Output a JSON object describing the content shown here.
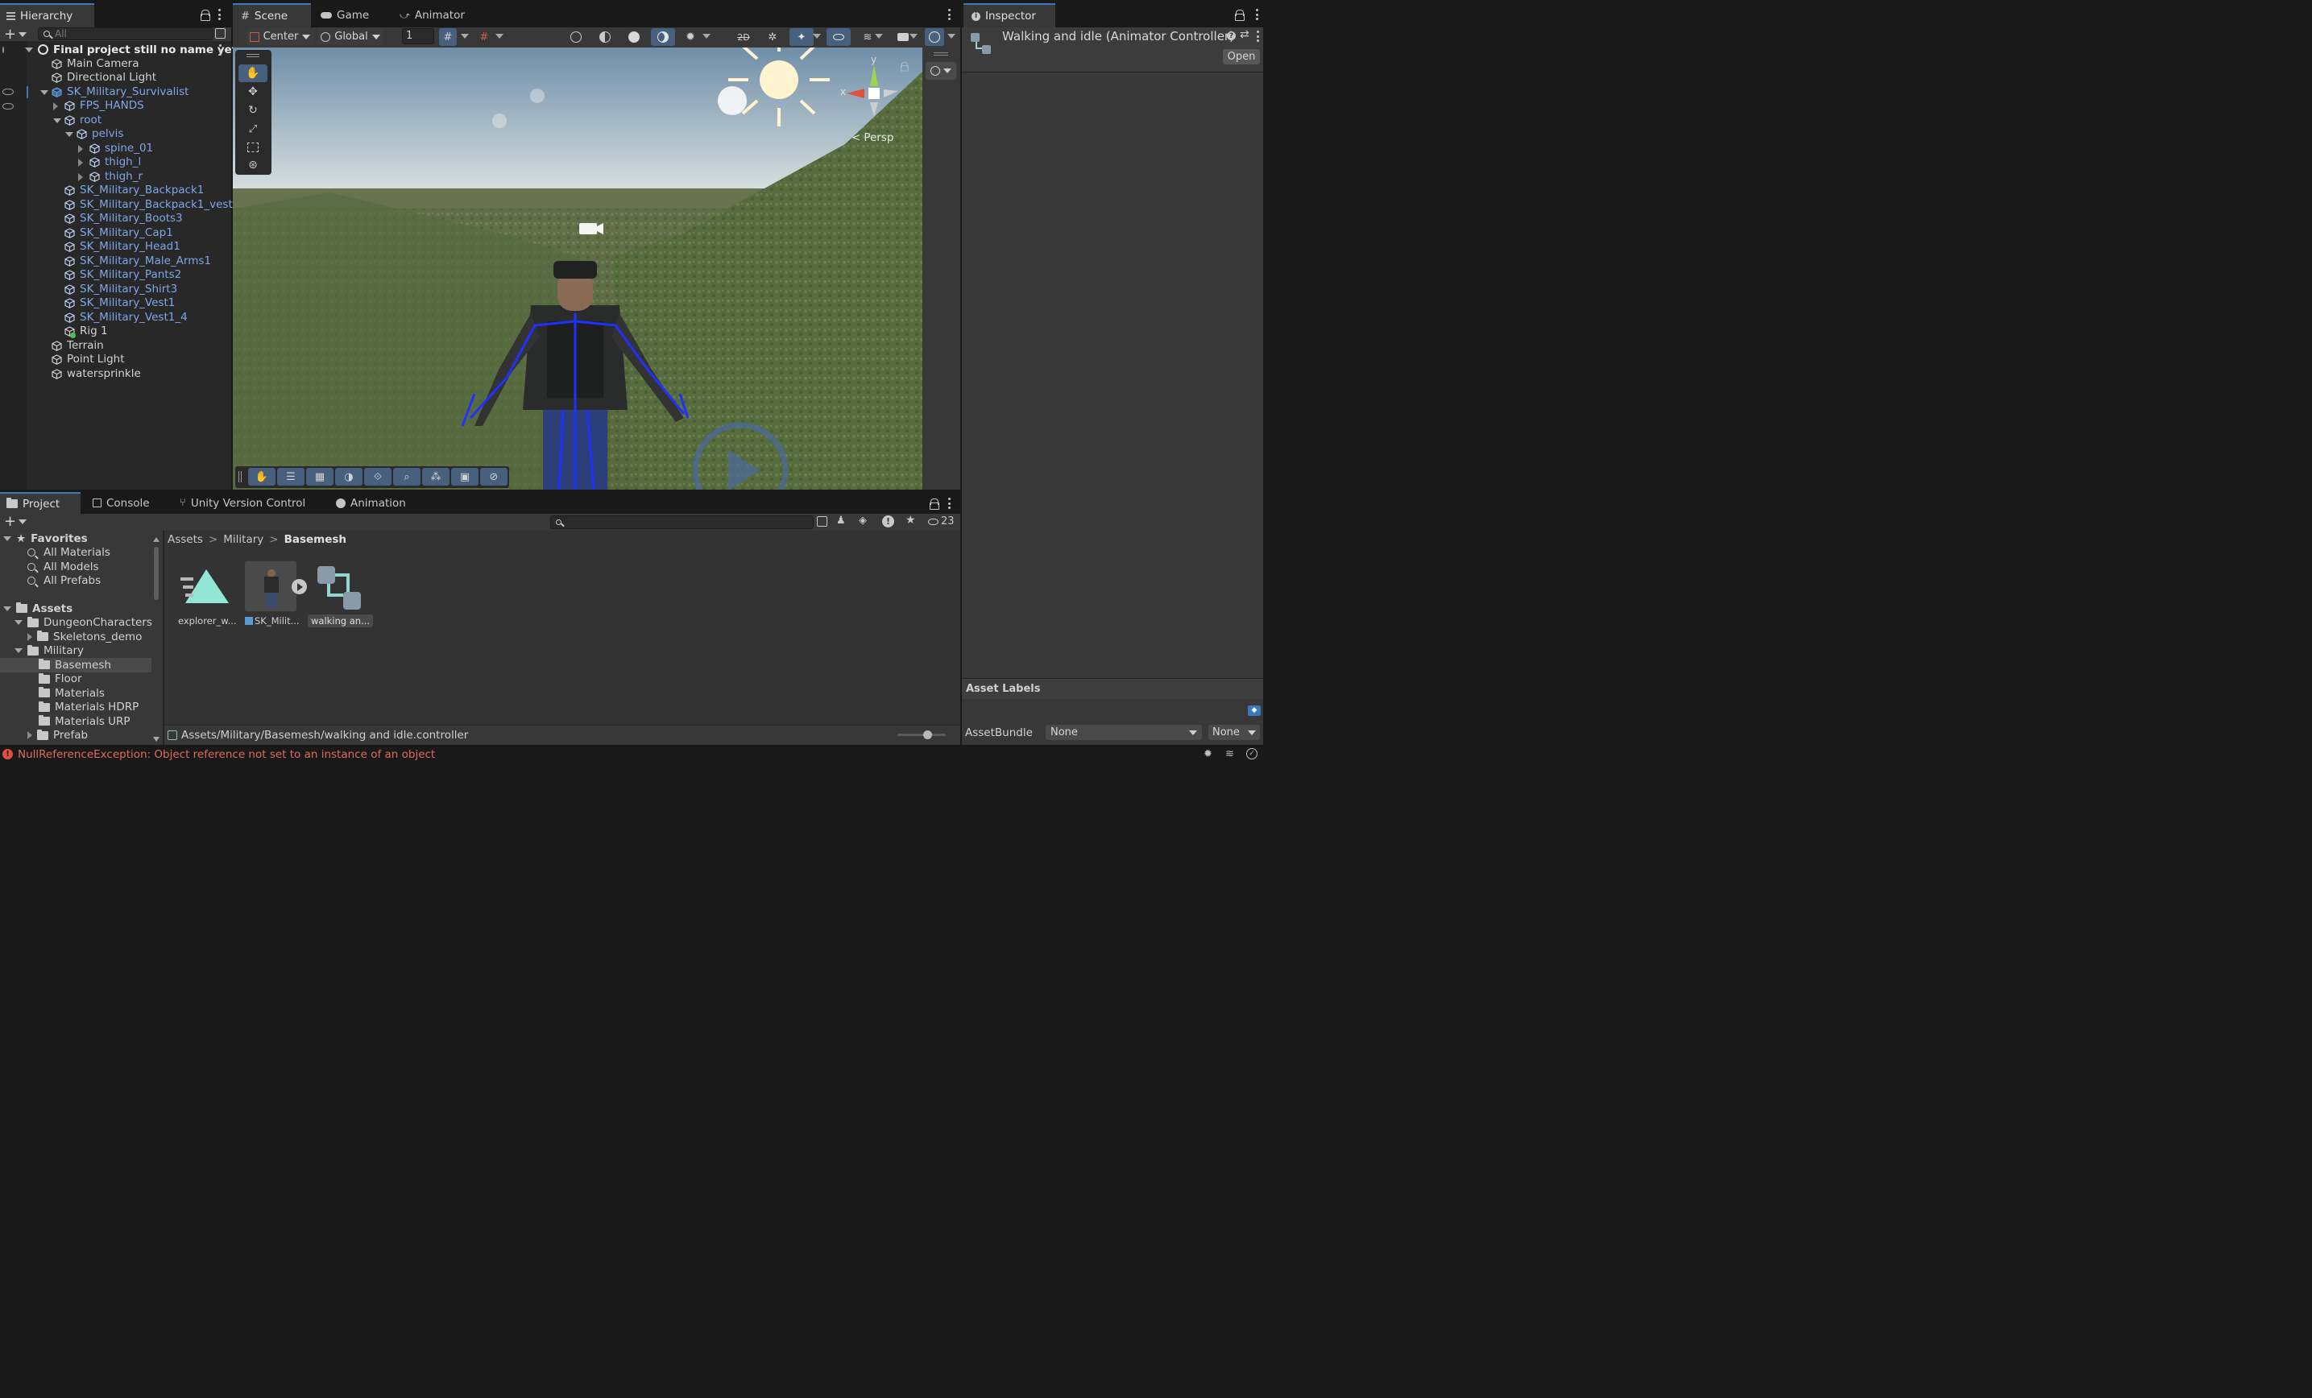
{
  "hierarchy": {
    "tab": "Hierarchy",
    "search_placeholder": "All",
    "scene_name": "Final project still no name yet",
    "items": [
      {
        "label": "Main Camera",
        "depth": 1,
        "blue": false
      },
      {
        "label": "Directional Light",
        "depth": 1,
        "blue": false
      },
      {
        "label": "SK_Military_Survivalist",
        "depth": 1,
        "blue": true
      },
      {
        "label": "FPS_HANDS",
        "depth": 2,
        "blue": true
      },
      {
        "label": "root",
        "depth": 2,
        "blue": true
      },
      {
        "label": "pelvis",
        "depth": 3,
        "blue": true
      },
      {
        "label": "spine_01",
        "depth": 4,
        "blue": true
      },
      {
        "label": "thigh_l",
        "depth": 4,
        "blue": true
      },
      {
        "label": "thigh_r",
        "depth": 4,
        "blue": true
      },
      {
        "label": "SK_Military_Backpack1",
        "depth": 2,
        "blue": true
      },
      {
        "label": "SK_Military_Backpack1_vest",
        "depth": 2,
        "blue": true
      },
      {
        "label": "SK_Military_Boots3",
        "depth": 2,
        "blue": true
      },
      {
        "label": "SK_Military_Cap1",
        "depth": 2,
        "blue": true
      },
      {
        "label": "SK_Military_Head1",
        "depth": 2,
        "blue": true
      },
      {
        "label": "SK_Military_Male_Arms1",
        "depth": 2,
        "blue": true
      },
      {
        "label": "SK_Military_Pants2",
        "depth": 2,
        "blue": true
      },
      {
        "label": "SK_Military_Shirt3",
        "depth": 2,
        "blue": true
      },
      {
        "label": "SK_Military_Vest1",
        "depth": 2,
        "blue": true
      },
      {
        "label": "SK_Military_Vest1_4",
        "depth": 2,
        "blue": true
      },
      {
        "label": "Rig 1",
        "depth": 2,
        "blue": false
      },
      {
        "label": "Terrain",
        "depth": 1,
        "blue": false
      },
      {
        "label": "Point Light",
        "depth": 1,
        "blue": false
      },
      {
        "label": "watersprinkle",
        "depth": 1,
        "blue": false
      }
    ]
  },
  "scene": {
    "tabs": [
      "Scene",
      "Game",
      "Animator"
    ],
    "pivot": "Center",
    "space": "Global",
    "grid_snap_value": "1",
    "persp_label": "Persp",
    "gizmo_x": "x",
    "gizmo_y": "y"
  },
  "inspector": {
    "tab": "Inspector",
    "title": "Walking and idle (Animator Controller)",
    "open_button": "Open",
    "asset_labels": "Asset Labels",
    "assetbundle_label": "AssetBundle",
    "assetbundle_value": "None",
    "variant_value": "None"
  },
  "project": {
    "tabs": [
      "Project",
      "Console",
      "Unity Version Control",
      "Animation"
    ],
    "visible_count": "23",
    "favorites_title": "Favorites",
    "favorites": [
      "All Materials",
      "All Models",
      "All Prefabs"
    ],
    "assets_title": "Assets",
    "folders": [
      {
        "label": "DungeonCharacters",
        "depth": 1,
        "expanded": true
      },
      {
        "label": "Skeletons_demo",
        "depth": 2,
        "expanded": false
      },
      {
        "label": "Military",
        "depth": 1,
        "expanded": true
      },
      {
        "label": "Basemesh",
        "depth": 2,
        "selected": true
      },
      {
        "label": "Floor",
        "depth": 2
      },
      {
        "label": "Materials",
        "depth": 2
      },
      {
        "label": "Materials HDRP",
        "depth": 2
      },
      {
        "label": "Materials URP",
        "depth": 2
      },
      {
        "label": "Prefab",
        "depth": 2,
        "expanded": false
      }
    ],
    "breadcrumb": [
      "Assets",
      "Military",
      "Basemesh"
    ],
    "files": [
      {
        "label": "explorer_w...",
        "icon": "animation-clip-icon"
      },
      {
        "label": "SK_Milit...",
        "icon": "model-prefab-icon"
      },
      {
        "label": "walking an...",
        "icon": "animator-controller-icon"
      }
    ],
    "status_path": "Assets/Military/Basemesh/walking and idle.controller"
  },
  "status_bar": {
    "error": "NullReferenceException: Object reference not set to an instance of an object",
    "error_color": "#e06c5c"
  },
  "colors": {
    "accent": "#3a79bb",
    "link_blue": "#7ea6e8",
    "panel": "#383838",
    "panel_dark": "#282828"
  }
}
